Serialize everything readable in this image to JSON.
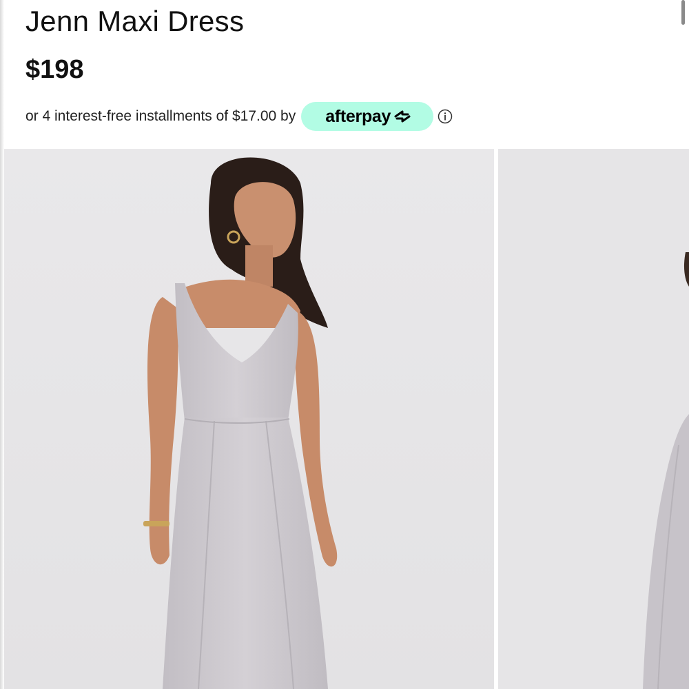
{
  "product": {
    "title": "Jenn Maxi Dress",
    "price": "$198"
  },
  "installments": {
    "text": "or 4 interest-free installments of $17.00 by",
    "provider": "afterpay",
    "provider_icon": "afterpay-arrows-icon",
    "badge_color": "#b2fce4",
    "info_icon": "info-icon"
  },
  "gallery": {
    "images": [
      {
        "name": "product-image-front",
        "description": "model in grey maxi dress"
      },
      {
        "name": "product-image-side",
        "description": "model in grey maxi dress, partially visible"
      }
    ]
  },
  "colors": {
    "dress": "#cfcbd0",
    "background": "#e6e5e7"
  }
}
